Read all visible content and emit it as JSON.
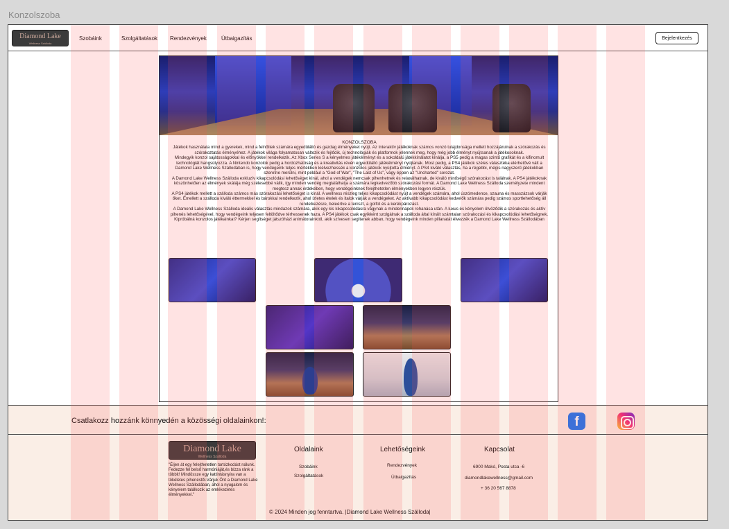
{
  "frame": {
    "title": "Konzolszoba"
  },
  "header": {
    "logo_main": "Diamond Lake",
    "logo_sub": "Wellness Szálloda",
    "nav": [
      "Szobáink",
      "Szolgáltatások",
      "Rendezvények",
      "Útbaigazítás"
    ],
    "login_label": "Bejelentkezés"
  },
  "article": {
    "title": "KONZOLSZOBA",
    "paragraphs": [
      "Játékok használata mind a gyerekek, mind a felnőttek számára egyedülálló és gazdag élményeket nyújt. Az Interaktív játékoknak számos vonzó tulajdonsága mellett hozzájárulnak a szórakozás és szórakoztatás élményéhez. A játékok világa folyamatosan változik és fejlődik, új technológiák és platformok jelennek meg, hogy még jobb élményt nyújtsanak a játékosoknak.",
      "Mindegyik konzol sajátosságokkal és előnyökkel rendelkezik. Az Xbox Series S a kényelmes játékélményt és a sokoldalú játékkínálatot kínálja, a PS5 pedig a magas szintű grafikát és a kifinomult technológiát hangsúlyozza. A Nintendo konzolok pedig a hordozhatóság és a kreativitás révén egyedülálló játékélményt nyújtanak. Most pedig, a PS4 játékok széles választéka elérhetővé vált a Damond Lake Wellness Szállodában is, hogy vendégeink teljes mértékben kiélvezhessék a konzolos játékok nyújtotta élményt. A PS4 kiváló választás, ha a régebbi, mégis nagyszerű játékokban szeretne merülni, mint például a \"God of War\", \"The Last of Us\", vagy éppen az \"Uncharted\" sorozat.",
      "A Damond Lake Wellness Szálloda exkluzív kikapcsolódási lehetőséget kínál, ahol a vendégek nemcsak pihenhetnek és relaxálhatnak, de kiváló minőségű szórakozást is találnak. A PS4 játékoknak köszönhetően az élmények skálája még szélesebbé válik, így minden vendég megtalálhatja a számára legkedvezőbb szórakozási formát. A Damond Lake Wellness Szálloda személyzete mindent megtesz annak érdekében, hogy vendégeinknek felejthetetlen élményekben legyen részük.",
      "A PS4 játékok mellett a szálloda számos más szórakozási lehetőséget is kínál. A wellness részleg teljes kikapcsolódást nyújt a vendégek számára, ahol úszómedence, szauna és masszázsok várják őket. Emellett a szálloda kiváló éttermekkel és bárokkal rendelkezik, ahol ízletes ételek és italok várják a vendégeket. Az aktívabb kikapcsolódást kedvelők számára pedig számos sportlehetőség áll rendelkezésre, beleértve a teniszt, a golfot és a kerékpározást.",
      "A Damond Lake Wellness Szálloda ideális választás mindazok számára, akik egy kis kikapcsolódásra vágynak a mindennapok rohanása után. A luxus és kényelem ötvöződik a szórakozás és aktív pihenés lehetőségével, hogy vendégeink teljesen feltöltődve térhessenek haza. A PS4 játékok csak egyikként szolgálnak a szálloda által kínált számtalan szórakozási és kikapcsolódási lehetőségnek.",
      "Kipróbálná konzolos játékainkat? Kérjen segítséget játszóházi animátorainktól, akik szívesen segítenek abban, hogy vendégeink minden pillanatát élvezzék a Damond Lake Wellness Szállodában"
    ]
  },
  "social": {
    "text": "Csatlakozz hozzánk könnyedén a közösségi oldalainkon!:"
  },
  "footer": {
    "logo_main": "Diamond Lake",
    "logo_sub": "Wellness Szálloda",
    "description": "\"Éljen át egy felejthetetlen tartózkodást nálunk. Fedezze fel belső harmóniáját,és bízza ránk a többit! Mindössze egy kattintásnyira van a tökéletes pihenéstől.Várjuk Önt a Diamond Lake Wellness Szállodában, ahol a nyugalom és kényelem találkozik az emlékezetes élményekkel.\"",
    "columns": [
      {
        "title": "Oldalaink",
        "links": [
          "Szobáink",
          "Szolgáltatások"
        ]
      },
      {
        "title": "Lehetőségeink",
        "links": [
          "Rendezvények",
          "Útbaigazítás"
        ]
      },
      {
        "title": "Kapcsolat",
        "links": [
          "6900 Makó, Posta utca -6",
          "diamondlakewellness@gmail.com",
          "+ 36 20 567 8878"
        ]
      }
    ],
    "copyright": "© 2024 Minden jog fenntartva. |Diamond Lake Wellness Szálloda|"
  },
  "icons": {
    "facebook": "facebook-icon",
    "instagram": "instagram-icon"
  },
  "colors": {
    "footer_bg": "#faeee6",
    "logo_bg": "#3b3b3b",
    "logo_text": "#c9a79a",
    "grid_overlay": "#ff5050"
  }
}
